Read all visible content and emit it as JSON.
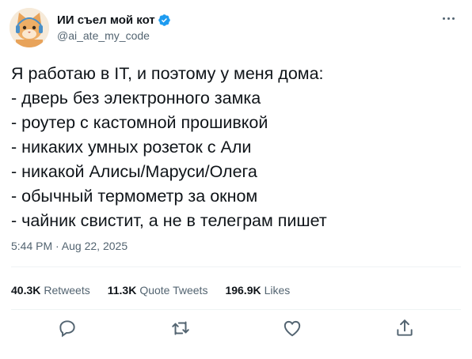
{
  "author": {
    "display_name": "ИИ съел мой кот",
    "handle": "@ai_ate_my_code",
    "verified": true,
    "avatar_icon": "cat-avatar-icon"
  },
  "tweet": {
    "text": "Я работаю в IT, и поэтому у меня дома:\n- дверь без электронного замка\n- роутер с кастомной прошивкой\n- никаких умных розеток с Али\n- никакой Алисы/Маруси/Олега\n- обычный термометр за окном\n- чайник свистит, а не в телеграм пишет",
    "timestamp": "5:44 PM · Aug 22, 2025"
  },
  "stats": [
    {
      "value": "40.3K",
      "label": "Retweets"
    },
    {
      "value": "11.3K",
      "label": "Quote Tweets"
    },
    {
      "value": "196.9K",
      "label": "Likes"
    }
  ],
  "actions": [
    {
      "name": "reply",
      "icon": "reply-icon"
    },
    {
      "name": "retweet",
      "icon": "retweet-icon"
    },
    {
      "name": "like",
      "icon": "heart-icon"
    },
    {
      "name": "share",
      "icon": "share-icon"
    }
  ],
  "colors": {
    "text": "#0f1419",
    "secondary": "#536471",
    "verified": "#1d9bf0",
    "divider": "#eff3f4"
  }
}
